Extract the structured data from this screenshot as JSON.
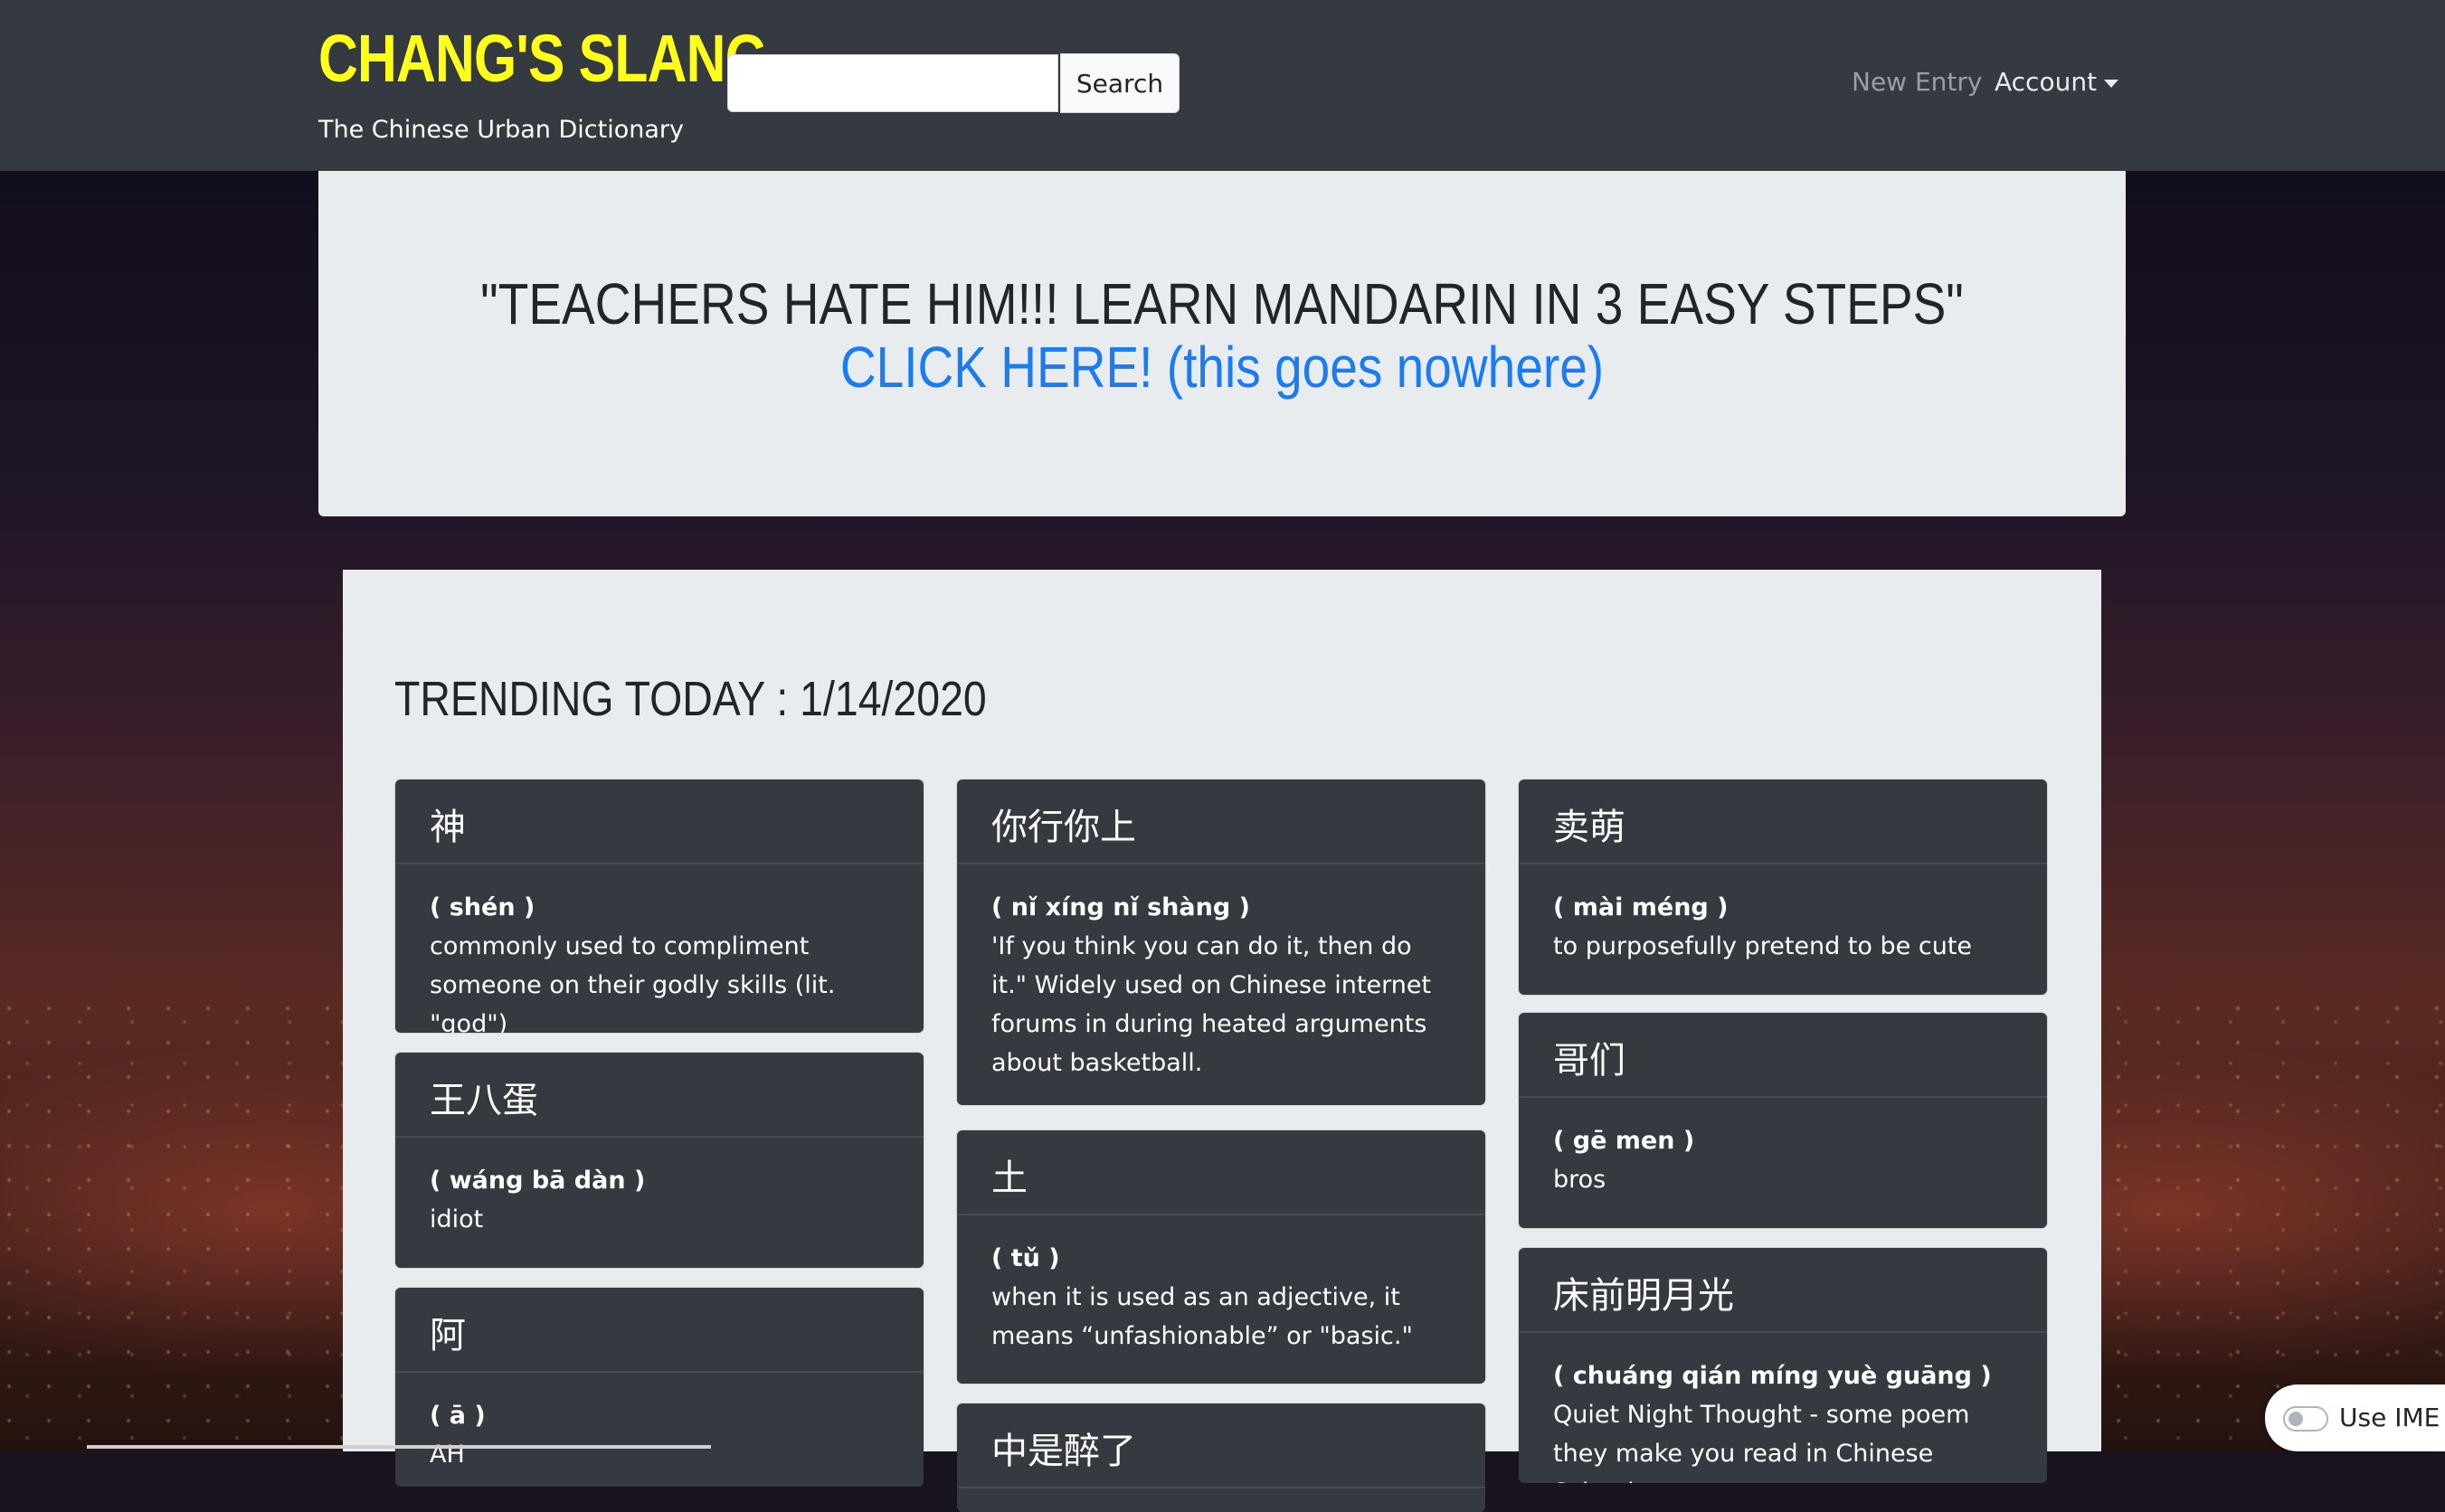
{
  "brand": {
    "title": "CHANG'S SLANG",
    "subtitle": "The Chinese Urban Dictionary",
    "title_color": "#ffff1a"
  },
  "search": {
    "value": "",
    "placeholder": "",
    "button_label": "Search"
  },
  "nav": {
    "new_entry": "New Entry",
    "account": "Account"
  },
  "ad": {
    "headline": "\"TEACHERS HATE HIM!!! LEARN MANDARIN IN 3 EASY STEPS\"",
    "link": "CLICK HERE! (this goes nowhere)",
    "link_color": "#1a7cf0"
  },
  "trending": {
    "title": "TRENDING TODAY : 1/14/2020",
    "cards": [
      {
        "hanzi": "神",
        "pinyin": "( shén )",
        "definition": "commonly used to compliment someone on their godly skills (lit. \"god\")"
      },
      {
        "hanzi": "你行你上",
        "pinyin": "( nǐ xíng nǐ shàng )",
        "definition": "'If you think you can do it, then do it.\" Widely used on Chinese internet forums in during heated arguments about basketball."
      },
      {
        "hanzi": "卖萌",
        "pinyin": "( mài méng )",
        "definition": "to purposefully pretend to be cute"
      },
      {
        "hanzi": "王八蛋",
        "pinyin": "( wáng bā dàn )",
        "definition": "idiot"
      },
      {
        "hanzi": "哥们",
        "pinyin": "( gē men )",
        "definition": "bros"
      },
      {
        "hanzi": "土",
        "pinyin": "( tǔ )",
        "definition": "when it is used as an adjective, it means “unfashionable” or \"basic.\""
      },
      {
        "hanzi": "阿",
        "pinyin": "( ā )",
        "definition": "AH"
      },
      {
        "hanzi": "床前明月光",
        "pinyin": "( chuáng qián míng yuè guāng )",
        "definition": "Quiet Night Thought - some poem they make you read in Chinese School"
      },
      {
        "hanzi": "中是醉了",
        "pinyin": "",
        "definition": ""
      }
    ]
  },
  "ime": {
    "label": "Use IME",
    "enabled": false
  }
}
